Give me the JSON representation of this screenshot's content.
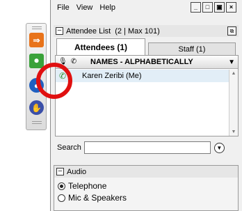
{
  "toolbar": {
    "buttons": [
      {
        "name": "arrow-icon",
        "color": "#e8731a",
        "glyph": "⇒"
      },
      {
        "name": "microphone-icon",
        "color": "#3aa23a",
        "glyph": "🎙"
      },
      {
        "name": "person-icon",
        "color": "#2060c0",
        "glyph": "●"
      },
      {
        "name": "hand-raise-icon",
        "color": "#3a4fa8",
        "glyph": "✋"
      }
    ]
  },
  "menu": {
    "items": [
      "File",
      "View",
      "Help"
    ]
  },
  "attendee_list": {
    "title": "Attendee List",
    "count_text": "(2 | Max 101)",
    "tabs": {
      "attendees": "Attendees (1)",
      "staff": "Staff (1)"
    },
    "column_header": "NAMES - ALPHABETICALLY",
    "rows": [
      {
        "name": "Karen Zeribi (Me)",
        "icon": "phone-icon"
      }
    ]
  },
  "search": {
    "label": "Search",
    "value": ""
  },
  "audio": {
    "title": "Audio",
    "options": [
      {
        "label": "Telephone",
        "selected": true
      },
      {
        "label": "Mic & Speakers",
        "selected": false
      }
    ]
  },
  "colors": {
    "highlight": "#e01010",
    "row_selected": "#e2eef7"
  }
}
